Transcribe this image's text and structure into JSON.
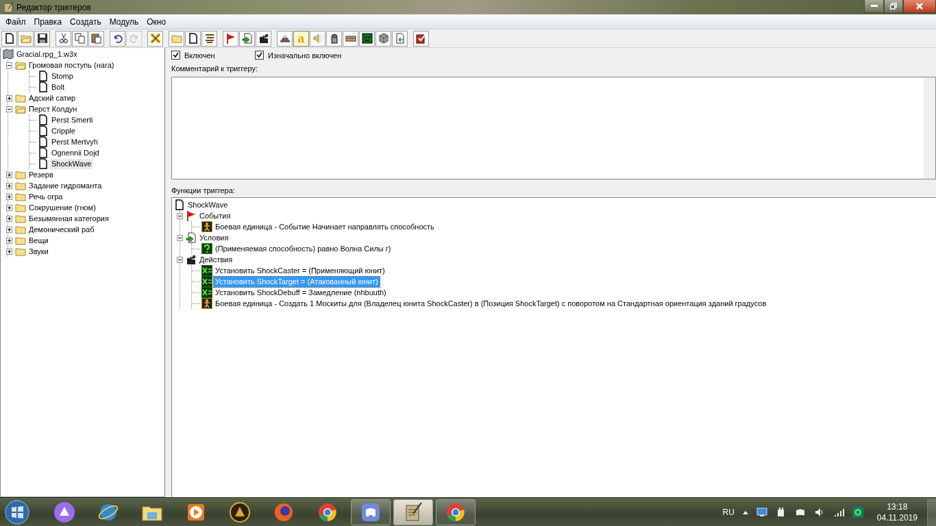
{
  "window": {
    "title": "Редактор триггеров"
  },
  "menu": [
    "Файл",
    "Правка",
    "Создать",
    "Модуль",
    "Окно"
  ],
  "toolbar": [
    [
      {
        "kind": "new",
        "disabled": false,
        "pressed": false
      },
      {
        "kind": "open",
        "disabled": false,
        "pressed": false
      },
      {
        "kind": "save",
        "disabled": false,
        "pressed": false
      }
    ],
    [
      {
        "kind": "cut",
        "disabled": false,
        "pressed": false
      },
      {
        "kind": "copy",
        "disabled": false,
        "pressed": false
      },
      {
        "kind": "paste",
        "disabled": false,
        "pressed": false
      }
    ],
    [
      {
        "kind": "undo",
        "disabled": false,
        "pressed": false
      },
      {
        "kind": "redo",
        "disabled": true,
        "pressed": false
      }
    ],
    [
      {
        "kind": "variables",
        "disabled": false,
        "pressed": false
      }
    ],
    [
      {
        "kind": "category",
        "disabled": false,
        "pressed": false
      },
      {
        "kind": "trigger",
        "disabled": false,
        "pressed": false
      },
      {
        "kind": "comment",
        "disabled": false,
        "pressed": false
      }
    ],
    [
      {
        "kind": "event",
        "disabled": false,
        "pressed": false
      },
      {
        "kind": "condition",
        "disabled": false,
        "pressed": false
      },
      {
        "kind": "action",
        "disabled": false,
        "pressed": false
      }
    ],
    [
      {
        "kind": "terrain",
        "disabled": false,
        "pressed": false
      },
      {
        "kind": "letter",
        "glyph": "a",
        "disabled": false,
        "pressed": true
      },
      {
        "kind": "sound",
        "disabled": false,
        "pressed": false
      },
      {
        "kind": "ghost",
        "disabled": false,
        "pressed": false
      },
      {
        "kind": "unit",
        "disabled": false,
        "pressed": false
      },
      {
        "kind": "monster",
        "disabled": false,
        "pressed": false
      },
      {
        "kind": "cube",
        "disabled": false,
        "pressed": false
      },
      {
        "kind": "import",
        "disabled": false,
        "pressed": false
      }
    ],
    [
      {
        "kind": "test",
        "disabled": false,
        "pressed": false
      }
    ]
  ],
  "tree": {
    "label": "Gracial.rpg_1.w3x",
    "children": [
      {
        "label": "Громовая поступь (нага)",
        "expanded": true,
        "children": [
          {
            "label": "Stomp",
            "selected": false
          },
          {
            "label": "Bolt",
            "selected": false
          }
        ]
      },
      {
        "label": "Адский сатир",
        "expanded": false
      },
      {
        "label": "Перст Колдун",
        "expanded": true,
        "children": [
          {
            "label": "Perst Smerti",
            "selected": false
          },
          {
            "label": "Cripple",
            "selected": false
          },
          {
            "label": "Perst Mertvyh",
            "selected": false
          },
          {
            "label": "Ognennii Dojd",
            "selected": false
          },
          {
            "label": "ShockWave",
            "selected": true
          }
        ]
      },
      {
        "label": "Резерв",
        "expanded": false
      },
      {
        "label": "Задание гидроманта",
        "expanded": false
      },
      {
        "label": "Речь огра",
        "expanded": false
      },
      {
        "label": "Сокрушение (гном)",
        "expanded": false
      },
      {
        "label": "Безымянная категория",
        "expanded": false
      },
      {
        "label": "Демонический раб",
        "expanded": false
      },
      {
        "label": "Вещи",
        "expanded": false
      },
      {
        "label": "Звуки",
        "expanded": false
      }
    ]
  },
  "options": [
    {
      "label": "Включен",
      "checked": true
    },
    {
      "label": "Изначально включен",
      "checked": true
    }
  ],
  "comment": {
    "label": "Комментарий к триггеру:"
  },
  "functions": {
    "label": "Функции триггера:",
    "trigger": "ShockWave",
    "sections": [
      {
        "kind": "events",
        "label": "События",
        "expanded": true,
        "items": [
          {
            "kind": "unit",
            "text": "Боевая единица - Событие Начинает направлять способность",
            "selected": false
          }
        ]
      },
      {
        "kind": "conditions",
        "label": "Условия",
        "expanded": true,
        "items": [
          {
            "kind": "condition",
            "text": "(Применяемая способность) равно Волна Силы г)",
            "selected": false
          }
        ]
      },
      {
        "kind": "actions",
        "label": "Действия",
        "expanded": true,
        "items": [
          {
            "kind": "set",
            "text": "Установить ShockCaster = (Применяющий юнит)",
            "selected": false
          },
          {
            "kind": "set",
            "text": "Установить ShockTarget = (Атакованный юнит)",
            "selected": true
          },
          {
            "kind": "set",
            "text": "Установить ShockDebuff = Замедление (nhbuuth)",
            "selected": false
          },
          {
            "kind": "unit",
            "text": "Боевая единица - Создать 1 Москиты для (Владелец юнита ShockCaster) в (Позиция ShockTarget) с поворотом на Стандартная ориентация зданий градусов",
            "selected": false
          }
        ]
      }
    ]
  },
  "taskbar": {
    "apps": [
      {
        "kind": "assistant",
        "running": false,
        "selected": false
      },
      {
        "kind": "browser-e",
        "running": false,
        "selected": false
      },
      {
        "kind": "files",
        "running": false,
        "selected": false
      },
      {
        "kind": "player",
        "running": false,
        "selected": false
      },
      {
        "kind": "music",
        "running": false,
        "selected": false
      },
      {
        "kind": "fox",
        "running": false,
        "selected": false
      },
      {
        "kind": "chrome",
        "running": false,
        "selected": false
      },
      {
        "kind": "chat",
        "running": true,
        "selected": false
      },
      {
        "kind": "editor",
        "running": true,
        "selected": true
      },
      {
        "kind": "chrome",
        "running": true,
        "selected": false
      }
    ],
    "language": "RU",
    "time": "13:18",
    "date": "04.11.2019"
  }
}
